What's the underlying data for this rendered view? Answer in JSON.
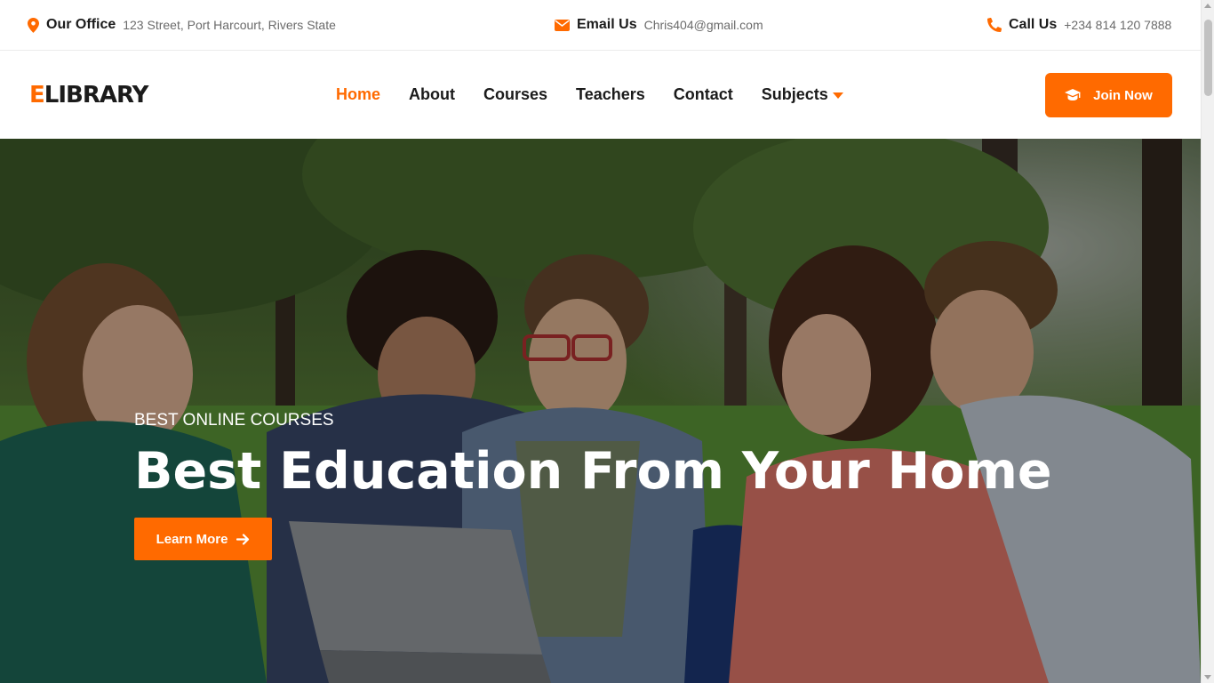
{
  "topbar": {
    "office": {
      "icon": "map-pin-icon",
      "label": "Our Office",
      "value": "123 Street, Port Harcourt, Rivers State"
    },
    "email": {
      "icon": "envelope-icon",
      "label": "Email Us",
      "value": "Chris404@gmail.com"
    },
    "call": {
      "icon": "phone-icon",
      "label": "Call Us",
      "value": "+234 814 120 7888"
    }
  },
  "brand": {
    "first_letter": "E",
    "rest": "LIBRARY"
  },
  "nav": {
    "items": [
      {
        "label": "Home",
        "active": true
      },
      {
        "label": "About"
      },
      {
        "label": "Courses"
      },
      {
        "label": "Teachers"
      },
      {
        "label": "Contact"
      },
      {
        "label": "Subjects",
        "dropdown": true
      }
    ],
    "join_button": {
      "icon": "graduation-cap-icon",
      "label": "Join Now"
    }
  },
  "hero": {
    "eyebrow": "BEST ONLINE COURSES",
    "headline": "Best Education From Your Home",
    "cta": {
      "label": "Learn More",
      "icon": "arrow-right-icon"
    },
    "image": "students-studying-outdoors-photo"
  },
  "colors": {
    "accent": "#ff6a00",
    "text": "#1b1b1b",
    "muted": "#6b6b6b"
  }
}
